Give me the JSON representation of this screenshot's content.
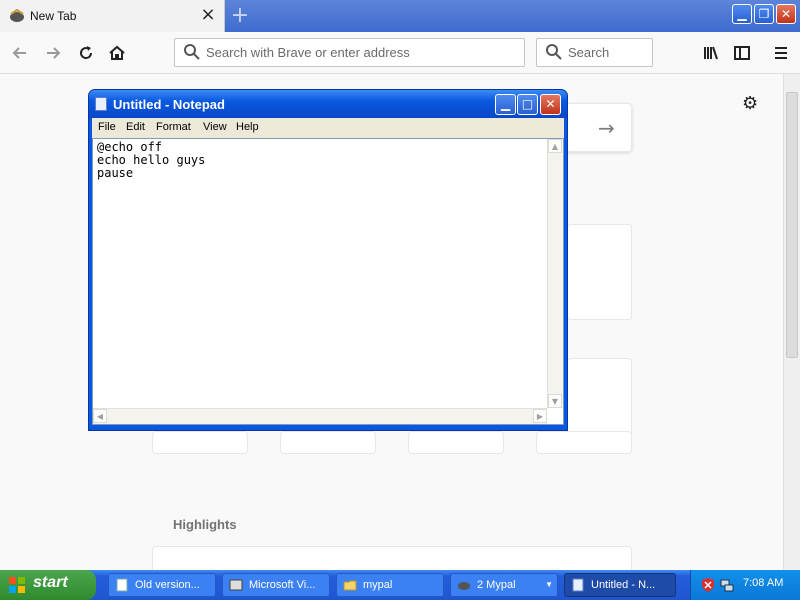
{
  "browser": {
    "tab_title": "New Tab",
    "tab_close": "×",
    "new_tab": "+",
    "window_controls": {
      "minimize": "▁",
      "maximize": "❐",
      "close": "✕"
    },
    "nav": {
      "back_icon": "arrow-left-icon",
      "forward_icon": "arrow-right-icon",
      "reload_icon": "reload-icon",
      "home_icon": "home-icon",
      "library_icon": "library-icon",
      "sidebar_icon": "sidebar-icon",
      "menu_icon": "menu-icon"
    },
    "url_placeholder": "Search with Brave or enter address",
    "search_placeholder": "Search"
  },
  "page": {
    "highlights_title": "Highlights",
    "search_arrow": "→",
    "settings_icon": "gear-icon"
  },
  "notepad": {
    "title": "Untitled - Notepad",
    "menu": [
      "File",
      "Edit",
      "Format",
      "View",
      "Help"
    ],
    "content": "@echo off\necho hello guys\npause",
    "controls": {
      "minimize": "▁",
      "maximize": "□",
      "close": "✕"
    }
  },
  "taskbar": {
    "start_label": "start",
    "tasks": [
      {
        "label": "Old version...",
        "icon": "document-icon"
      },
      {
        "label": "Microsoft Vi...",
        "icon": "visual-studio-icon"
      },
      {
        "label": "mypal",
        "icon": "folder-icon"
      },
      {
        "label": "2 Mypal",
        "icon": "mypal-icon"
      },
      {
        "label": "Untitled - N...",
        "icon": "notepad-icon"
      }
    ],
    "clock": "7:08 AM"
  },
  "colors": {
    "xp_blue": "#0a58e0",
    "start_green": "#2d8b2d",
    "page_bg": "#f9f9fa"
  }
}
